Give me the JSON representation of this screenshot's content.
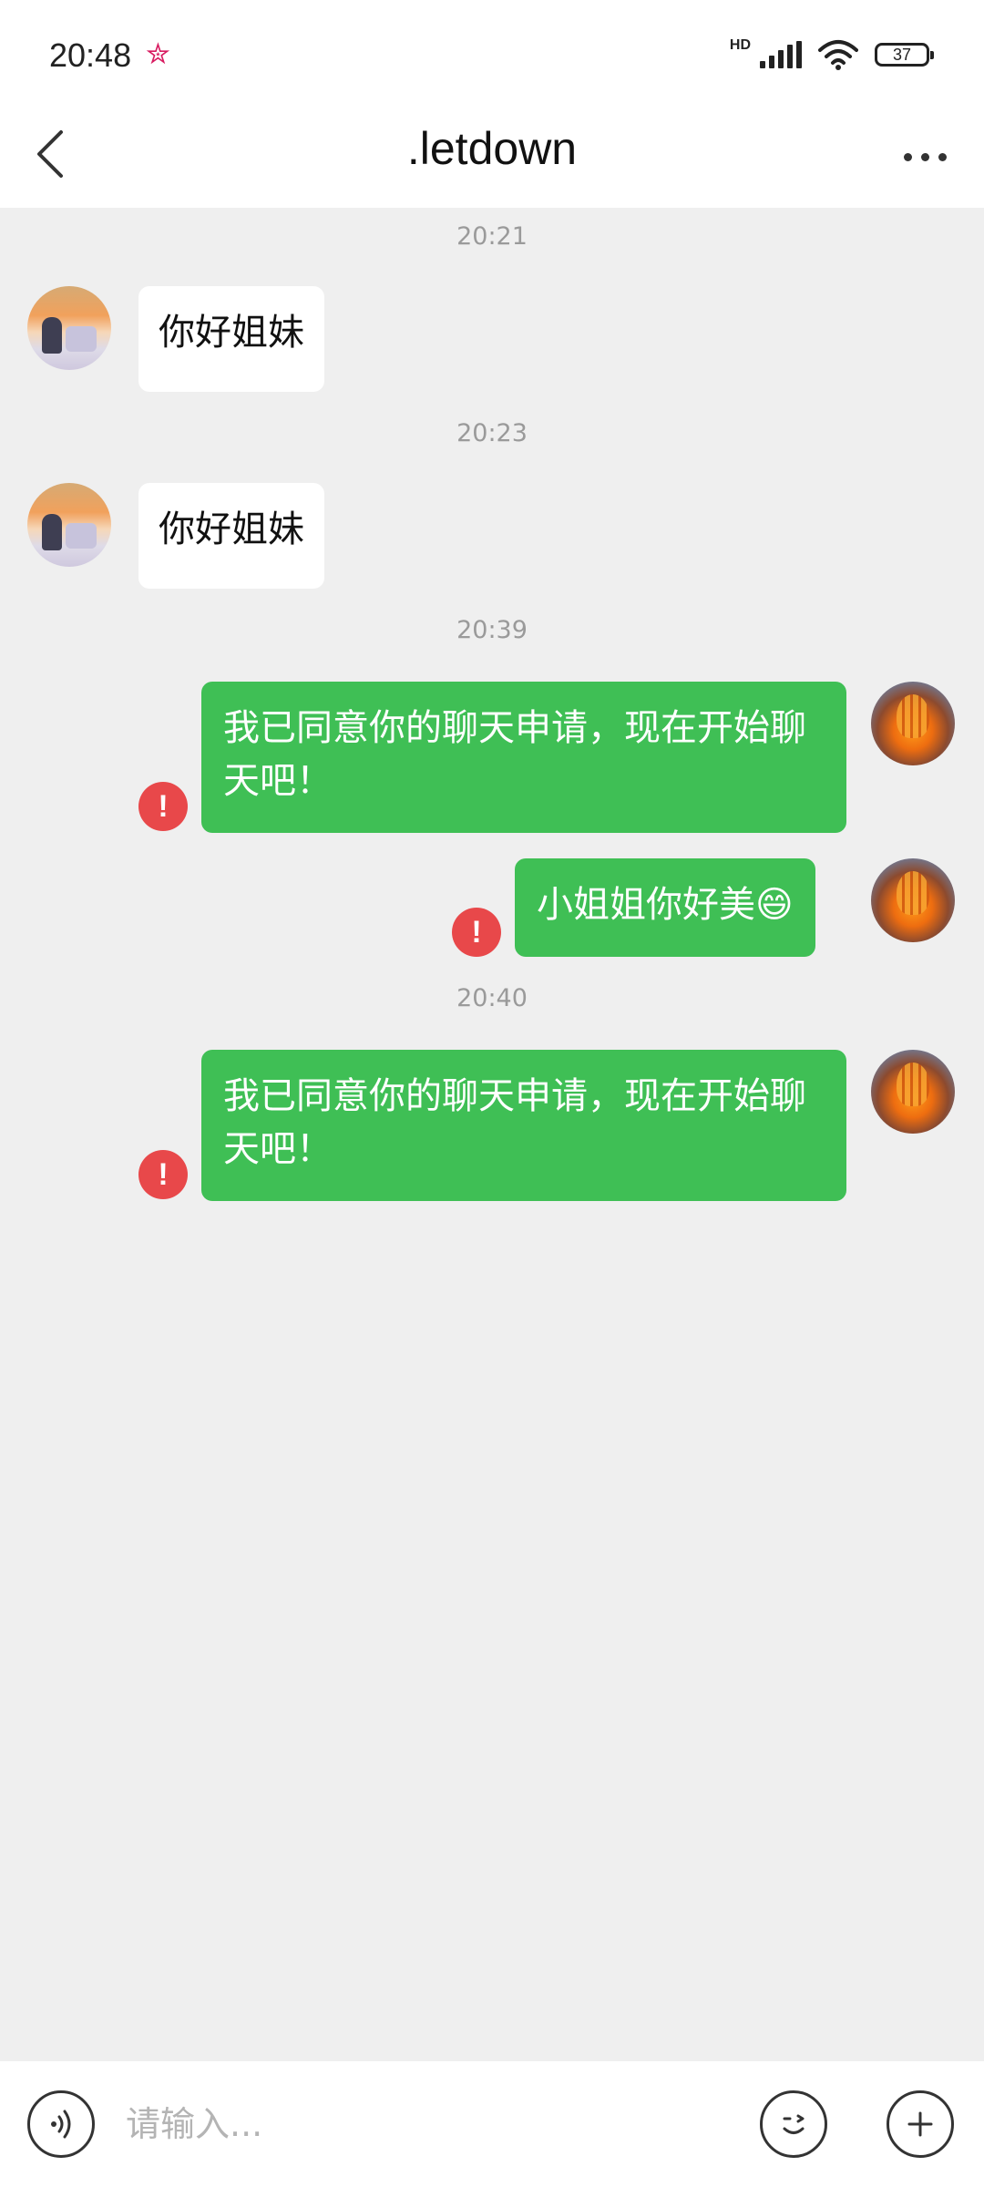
{
  "status_bar": {
    "time": "20:48",
    "network_label": "HD",
    "battery_level": "37",
    "icons": [
      "star-icon",
      "signal-icon",
      "wifi-icon",
      "battery-icon"
    ]
  },
  "header": {
    "title": ".letdown",
    "back_icon": "chevron-left-icon",
    "more_icon": "more-dots-icon"
  },
  "messages": [
    {
      "type": "timestamp",
      "text": "20:21"
    },
    {
      "type": "received",
      "text": "你好姐妹"
    },
    {
      "type": "timestamp",
      "text": "20:23"
    },
    {
      "type": "received",
      "text": "你好姐妹"
    },
    {
      "type": "timestamp",
      "text": "20:39"
    },
    {
      "type": "sent",
      "text": "我已同意你的聊天申请，现在开始聊天吧！",
      "failed": true
    },
    {
      "type": "sent",
      "text": "小姐姐你好美😄",
      "failed": true
    },
    {
      "type": "timestamp",
      "text": "20:40"
    },
    {
      "type": "sent",
      "text": "我已同意你的聊天申请，现在开始聊天吧！",
      "failed": true
    }
  ],
  "error_glyph": "!",
  "input_bar": {
    "placeholder": "请输入...",
    "voice_icon": "voice-icon",
    "emoji_icon": "emoji-icon",
    "plus_icon": "plus-icon"
  },
  "colors": {
    "sent_bubble": "#3fbf55",
    "received_bubble": "#ffffff",
    "error": "#e8484a",
    "background": "#efefef"
  }
}
